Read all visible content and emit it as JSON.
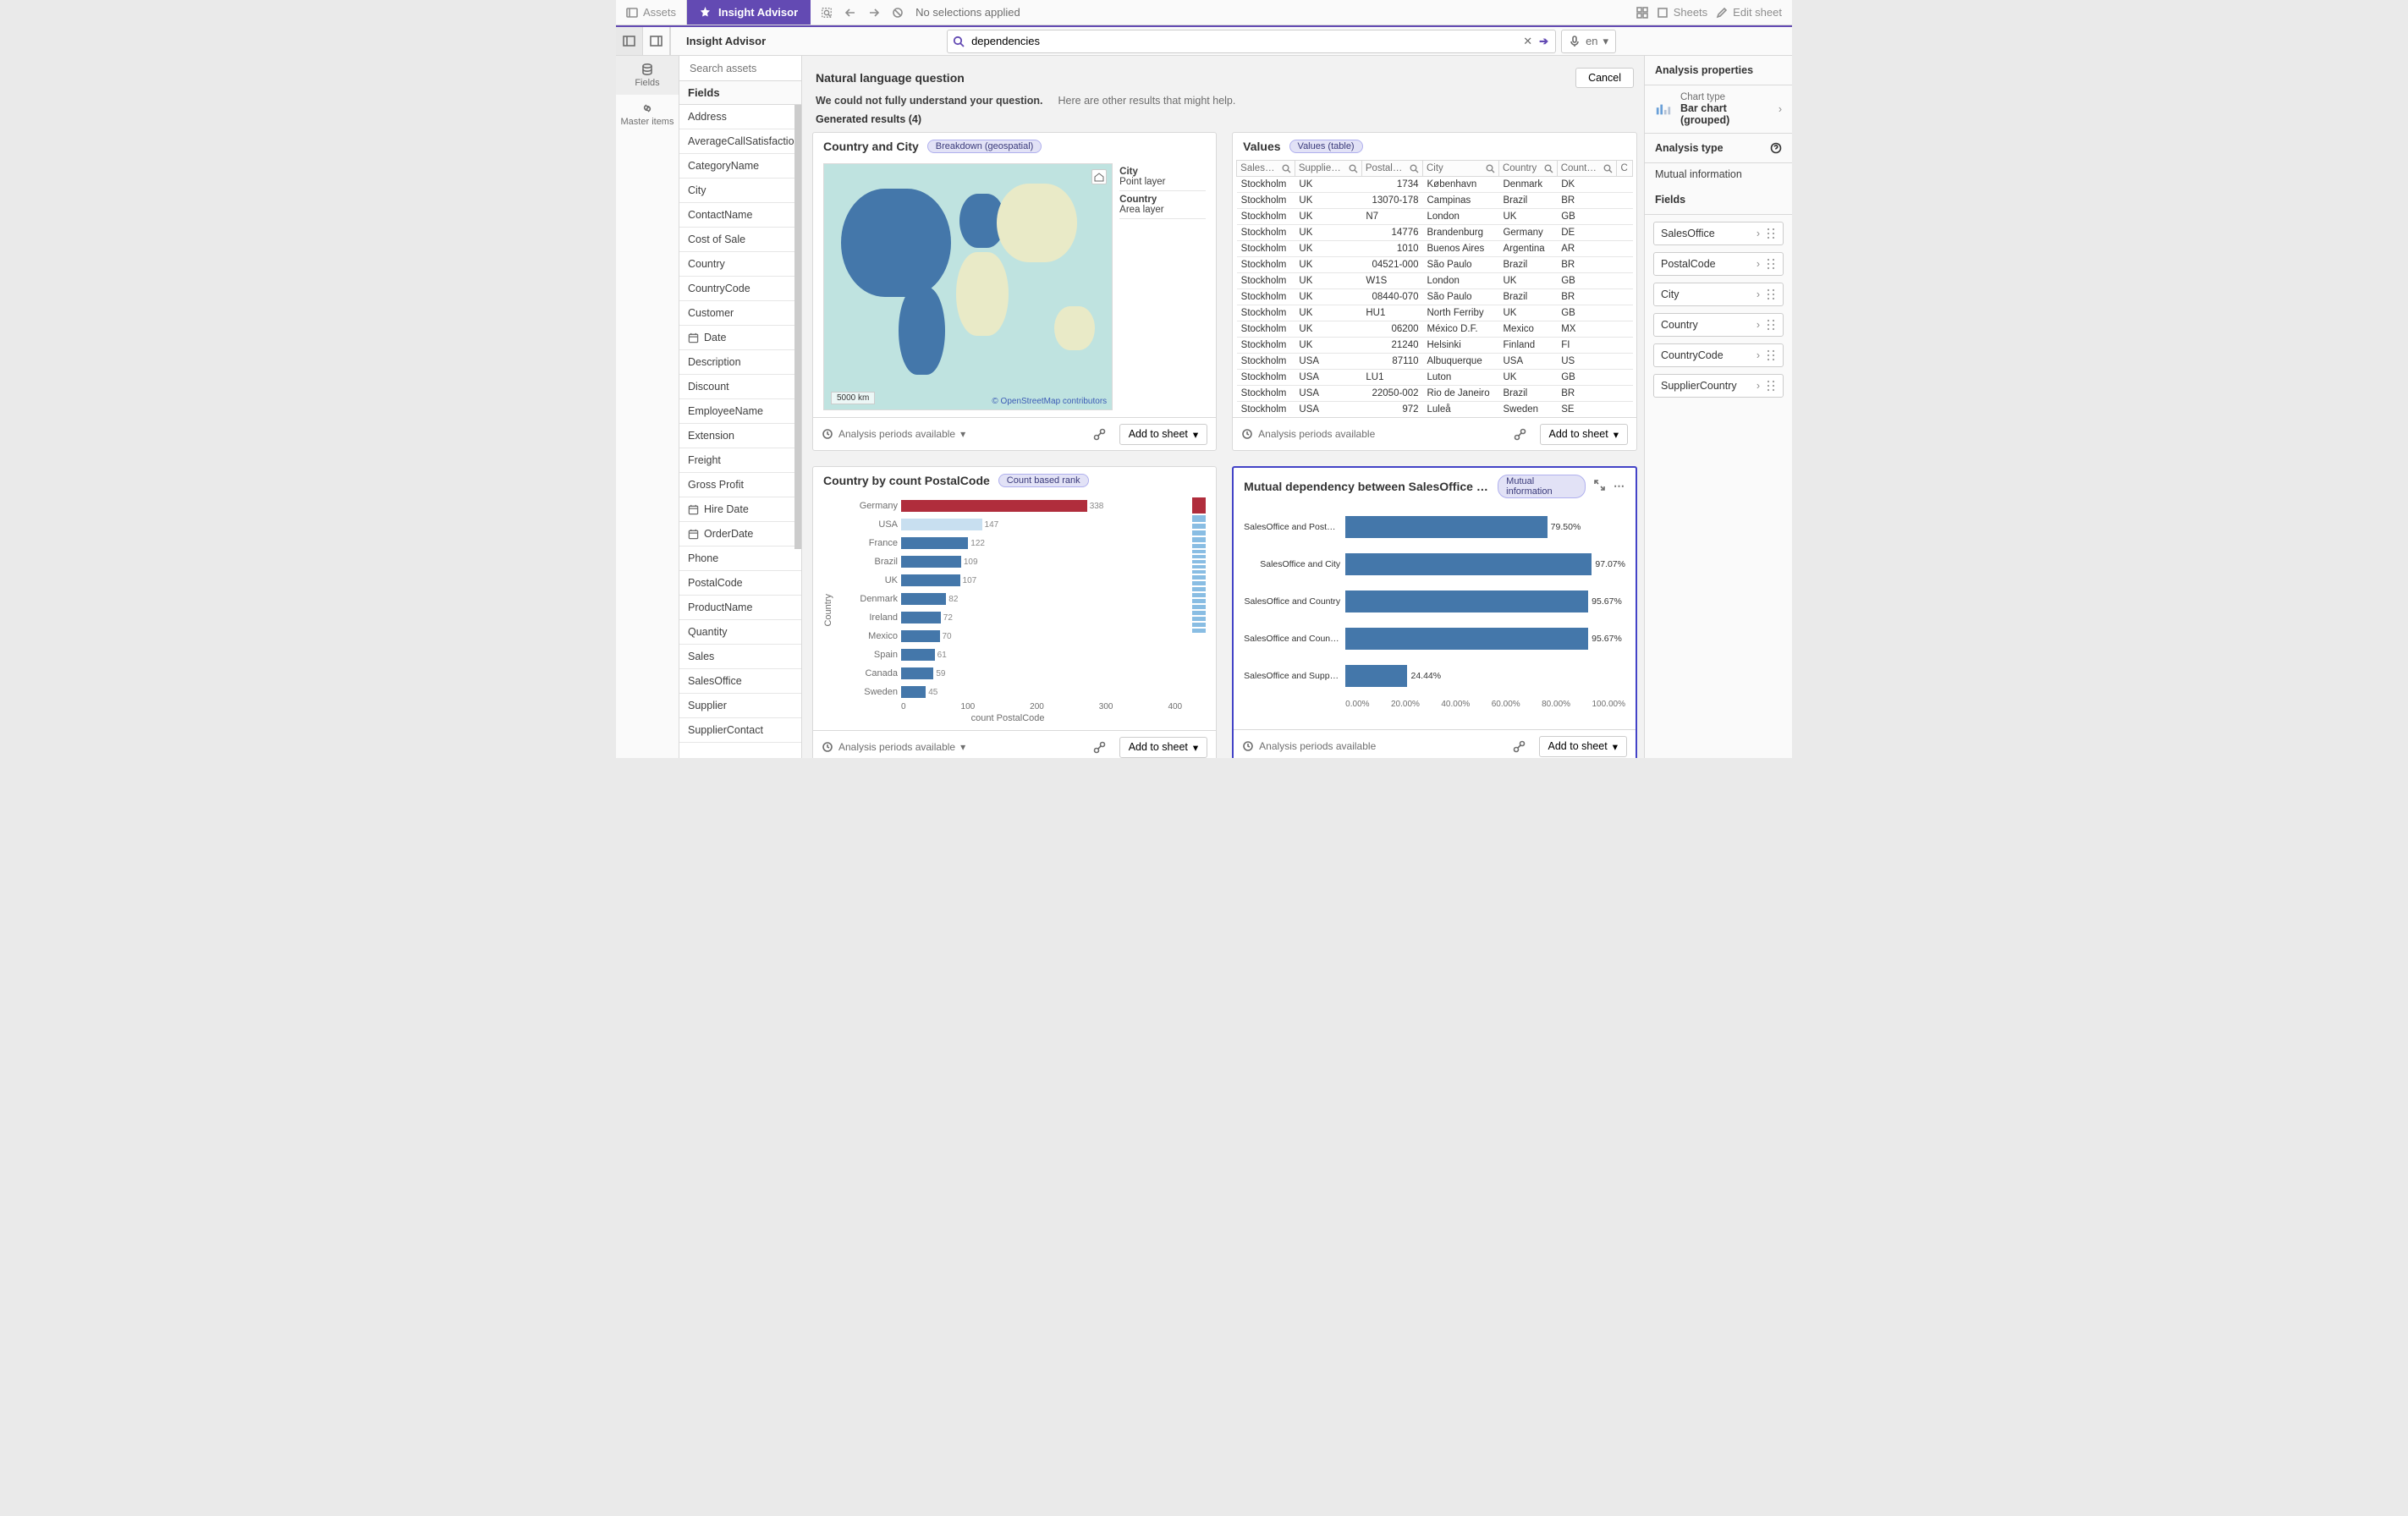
{
  "topbar": {
    "assets": "Assets",
    "insight_advisor": "Insight Advisor",
    "no_selections": "No selections applied",
    "sheets": "Sheets",
    "edit_sheet": "Edit sheet"
  },
  "subbar": {
    "insight_label": "Insight Advisor",
    "search_value": "dependencies",
    "lang": "en"
  },
  "rail": {
    "fields": "Fields",
    "master": "Master items"
  },
  "field_panel": {
    "search_placeholder": "Search assets",
    "header": "Fields",
    "items": [
      {
        "label": "Address"
      },
      {
        "label": "AverageCallSatisfaction"
      },
      {
        "label": "CategoryName"
      },
      {
        "label": "City"
      },
      {
        "label": "ContactName"
      },
      {
        "label": "Cost of Sale"
      },
      {
        "label": "Country"
      },
      {
        "label": "CountryCode"
      },
      {
        "label": "Customer"
      },
      {
        "label": "Date",
        "date": true
      },
      {
        "label": "Description"
      },
      {
        "label": "Discount"
      },
      {
        "label": "EmployeeName"
      },
      {
        "label": "Extension"
      },
      {
        "label": "Freight"
      },
      {
        "label": "Gross Profit"
      },
      {
        "label": "Hire Date",
        "date": true
      },
      {
        "label": "OrderDate",
        "date": true
      },
      {
        "label": "Phone"
      },
      {
        "label": "PostalCode"
      },
      {
        "label": "ProductName"
      },
      {
        "label": "Quantity"
      },
      {
        "label": "Sales"
      },
      {
        "label": "SalesOffice"
      },
      {
        "label": "Supplier"
      },
      {
        "label": "SupplierContact"
      }
    ]
  },
  "canvas": {
    "title": "Natural language question",
    "cancel": "Cancel",
    "warn": "We could not fully understand your question.",
    "hint": "Here are other results that might help.",
    "generated_label": "Generated results (4)"
  },
  "cards": {
    "map": {
      "title": "Country and City",
      "chip": "Breakdown (geospatial)",
      "legend": {
        "l1a": "City",
        "l1b": "Point layer",
        "l2a": "Country",
        "l2b": "Area layer"
      },
      "scale": "5000 km",
      "osm": "© OpenStreetMap contributors",
      "periods": "Analysis periods available",
      "add": "Add to sheet"
    },
    "table": {
      "title": "Values",
      "chip": "Values (table)",
      "cols": [
        "Sales…",
        "Supplie…",
        "Postal…",
        "City",
        "Country",
        "Count…",
        "C"
      ],
      "rows": [
        [
          "Stockholm",
          "UK",
          "1734",
          "København",
          "Denmark",
          "DK"
        ],
        [
          "Stockholm",
          "UK",
          "13070-178",
          "Campinas",
          "Brazil",
          "BR"
        ],
        [
          "Stockholm",
          "UK",
          "N7",
          "London",
          "UK",
          "GB"
        ],
        [
          "Stockholm",
          "UK",
          "14776",
          "Brandenburg",
          "Germany",
          "DE"
        ],
        [
          "Stockholm",
          "UK",
          "1010",
          "Buenos Aires",
          "Argentina",
          "AR"
        ],
        [
          "Stockholm",
          "UK",
          "04521-000",
          "São Paulo",
          "Brazil",
          "BR"
        ],
        [
          "Stockholm",
          "UK",
          "W1S",
          "London",
          "UK",
          "GB"
        ],
        [
          "Stockholm",
          "UK",
          "08440-070",
          "São Paulo",
          "Brazil",
          "BR"
        ],
        [
          "Stockholm",
          "UK",
          "HU1",
          "North Ferriby",
          "UK",
          "GB"
        ],
        [
          "Stockholm",
          "UK",
          "06200",
          "México D.F.",
          "Mexico",
          "MX"
        ],
        [
          "Stockholm",
          "UK",
          "21240",
          "Helsinki",
          "Finland",
          "FI"
        ],
        [
          "Stockholm",
          "USA",
          "87110",
          "Albuquerque",
          "USA",
          "US"
        ],
        [
          "Stockholm",
          "USA",
          "LU1",
          "Luton",
          "UK",
          "GB"
        ],
        [
          "Stockholm",
          "USA",
          "22050-002",
          "Rio de Janeiro",
          "Brazil",
          "BR"
        ],
        [
          "Stockholm",
          "USA",
          "972",
          "Luleå",
          "Sweden",
          "SE"
        ]
      ],
      "periods": "Analysis periods available",
      "add": "Add to sheet"
    },
    "countrybar": {
      "title": "Country by count PostalCode",
      "chip": "Count based rank",
      "ylabel": "Country",
      "xlabel": "count PostalCode",
      "periods": "Analysis periods available",
      "add": "Add to sheet"
    },
    "mutual": {
      "title": "Mutual dependency between SalesOffice and selected it…",
      "chip": "Mutual information",
      "periods": "Analysis periods available",
      "add": "Add to sheet"
    }
  },
  "props": {
    "header": "Analysis properties",
    "chart_type_label": "Chart type",
    "chart_type_value": "Bar chart (grouped)",
    "analysis_type_header": "Analysis type",
    "analysis_type_value": "Mutual information",
    "fields_header": "Fields",
    "fields": [
      "SalesOffice",
      "PostalCode",
      "City",
      "Country",
      "CountryCode",
      "SupplierCountry"
    ]
  },
  "chart_data": [
    {
      "type": "bar",
      "title": "Country by count PostalCode",
      "xlabel": "count PostalCode",
      "ylabel": "Country",
      "xlim": [
        0,
        400
      ],
      "xticks": [
        0,
        100,
        200,
        300,
        400
      ],
      "categories": [
        "Germany",
        "USA",
        "France",
        "Brazil",
        "UK",
        "Denmark",
        "Ireland",
        "Mexico",
        "Spain",
        "Canada",
        "Sweden"
      ],
      "values": [
        338,
        147,
        122,
        109,
        107,
        82,
        72,
        70,
        61,
        59,
        45
      ]
    },
    {
      "type": "bar",
      "title": "Mutual dependency between SalesOffice and selected items",
      "xlabel": "",
      "ylabel": "",
      "xlim": [
        0,
        100
      ],
      "xticks": [
        "0.00%",
        "20.00%",
        "40.00%",
        "60.00%",
        "80.00%",
        "100.00%"
      ],
      "categories": [
        "SalesOffice and PostalCode",
        "SalesOffice and City",
        "SalesOffice and Country",
        "SalesOffice and CountryCo…",
        "SalesOffice and SupplierC…"
      ],
      "values": [
        79.5,
        97.07,
        95.67,
        95.67,
        24.44
      ],
      "value_labels": [
        "79.50%",
        "97.07%",
        "95.67%",
        "95.67%",
        "24.44%"
      ]
    }
  ],
  "colors": {
    "bar_blue": "#4477aa",
    "bar_red": "#b02d3c",
    "purple": "#634ab3"
  }
}
